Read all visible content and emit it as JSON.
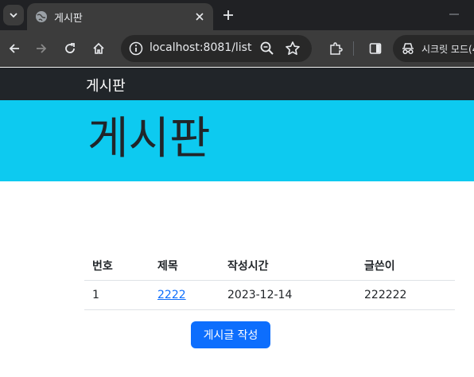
{
  "browser": {
    "tab_title": "게시판",
    "url_host": "localhost",
    "url_rest": ":8081/list",
    "incognito_label": "시크릿 모드(4"
  },
  "page": {
    "navbar_brand": "게시판",
    "hero_title": "게시판",
    "table": {
      "headers": [
        "번호",
        "제목",
        "작성시간",
        "글쓴이"
      ],
      "rows": [
        {
          "no": "1",
          "title": "2222",
          "time": "2023-12-14",
          "author": "222222"
        }
      ]
    },
    "write_button": "게시글 작성"
  },
  "colors": {
    "navbar": "#212529",
    "hero": "#0dcaf0",
    "primary": "#0d6efd"
  }
}
